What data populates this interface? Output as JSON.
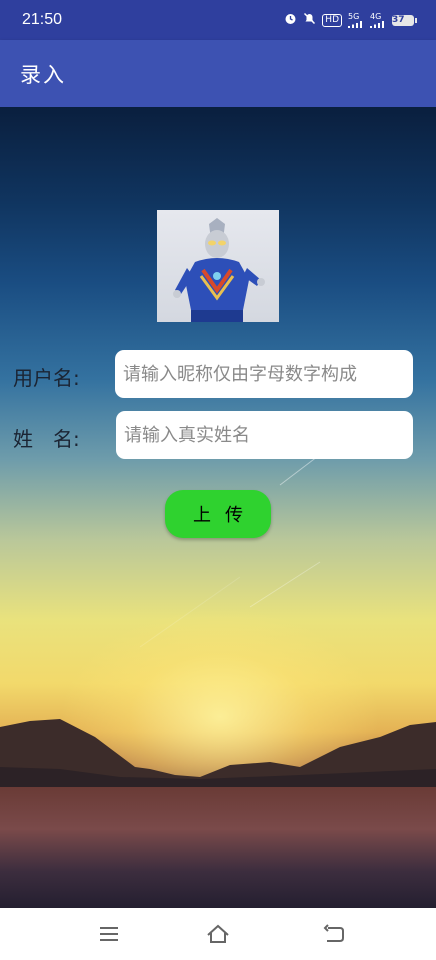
{
  "status_bar": {
    "time": "21:50",
    "icons": [
      "alarm-icon",
      "mute-icon",
      "hd-icon",
      "5g-signal-icon",
      "4g-signal-icon",
      "battery-icon"
    ],
    "hd_text": "HD",
    "net_5g": "5G",
    "net_4g": "4G",
    "battery_level": "37"
  },
  "app_bar": {
    "title": "录入"
  },
  "form": {
    "username_label": "用户名:",
    "username_placeholder": "请输入昵称仅由字母数字构成",
    "name_label": "姓　名:",
    "name_placeholder": "请输入真实姓名",
    "upload_label": "上传"
  },
  "nav_bar": {
    "icons": [
      "menu-icon",
      "home-icon",
      "back-icon"
    ]
  },
  "colors": {
    "status_bar": "#2f3f9e",
    "app_bar": "#3d52b2",
    "upload_button": "#2fd22f"
  }
}
